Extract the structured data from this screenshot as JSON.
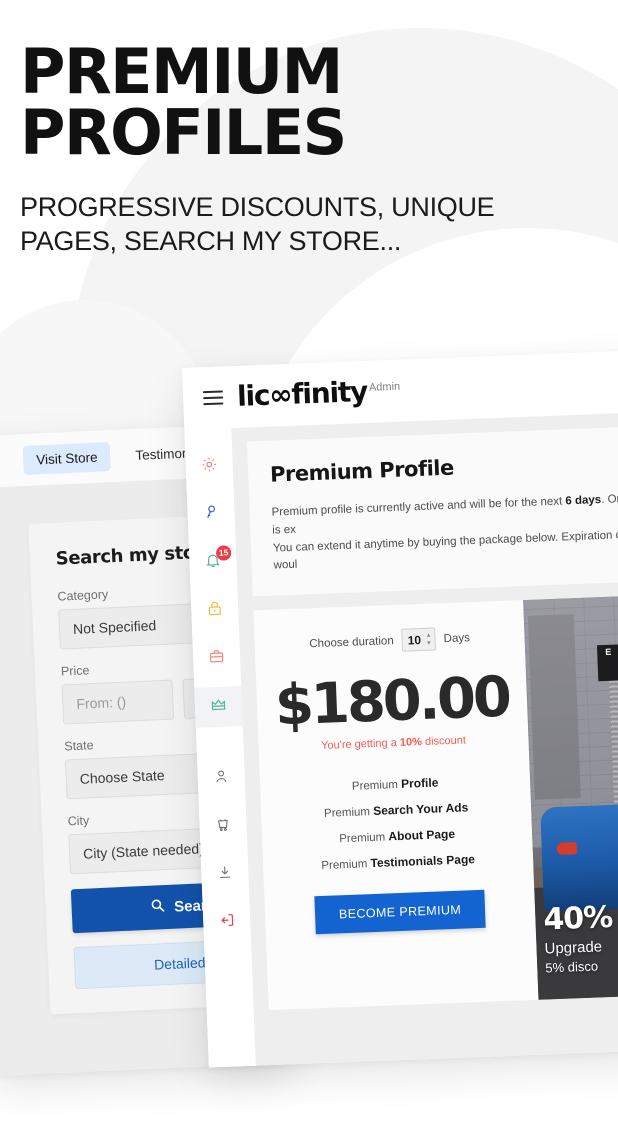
{
  "poster": {
    "headline": "PREMIUM\nPROFILES",
    "subheadline": "PROGRESSIVE DISCOUNTS, UNIQUE\nPAGES, SEARCH MY STORE..."
  },
  "colors": {
    "accent_blue": "#1363d0",
    "search_blue": "#1252ab",
    "discount_red": "#f35d52",
    "badge_red": "#ef3b45",
    "tab_active_bg": "#dbeafc",
    "page_bg": "#ffffff",
    "arch_grey": "#f4f4f4"
  },
  "left_window": {
    "tabs": [
      {
        "label": "Visit Store",
        "active": true
      },
      {
        "label": "Testimon",
        "active": false
      }
    ],
    "panel": {
      "title": "Search my store",
      "fields": [
        {
          "label": "Category",
          "value": "Not Specified"
        },
        {
          "label": "Price",
          "value": "From: ()",
          "value2": ""
        },
        {
          "label": "State",
          "value": "Choose State"
        },
        {
          "label": "City",
          "value": "City (State needed)"
        }
      ],
      "search_button": "Search",
      "search_icon": "search-icon",
      "detailed_button": "Detailed Se"
    }
  },
  "admin_window": {
    "topbar": {
      "menu_icon": "hamburger-icon",
      "brand": "lic∞finity",
      "brand_suffix": "Admin"
    },
    "sidebar": [
      {
        "name": "settings",
        "icon": "gear-icon",
        "color": "#f0736b",
        "badge": null,
        "active": false
      },
      {
        "name": "key",
        "icon": "key-icon",
        "color": "#3b62c9",
        "badge": null,
        "active": false
      },
      {
        "name": "notifications",
        "icon": "bell-icon",
        "color": "#4cae94",
        "badge": "15",
        "active": false
      },
      {
        "name": "lock",
        "icon": "lock-icon",
        "color": "#eebc3a",
        "badge": null,
        "active": false
      },
      {
        "name": "briefcase",
        "icon": "briefcase-icon",
        "color": "#ef8d7c",
        "badge": null,
        "active": false
      },
      {
        "name": "premium",
        "icon": "crown-icon",
        "color": "#57b894",
        "badge": null,
        "active": true
      },
      {
        "name": "profile",
        "icon": "person-icon",
        "color": "#6d6d6d",
        "badge": null,
        "active": false
      },
      {
        "name": "cart",
        "icon": "cart-icon",
        "color": "#6d6d6d",
        "badge": null,
        "active": false
      },
      {
        "name": "download",
        "icon": "download-icon",
        "color": "#6d6d6d",
        "badge": null,
        "active": false
      },
      {
        "name": "logout",
        "icon": "logout-icon",
        "color": "#ef3b45",
        "badge": null,
        "active": false
      }
    ],
    "page": {
      "title": "Premium Profile",
      "description_line1_a": "Premium profile is currently active and will be for the next ",
      "description_days": "6 days",
      "description_line1_b": ". Once it is ex",
      "description_line2": "You can extend it anytime by buying the package below. Expiration date woul"
    },
    "buy": {
      "duration_label": "Choose duration",
      "duration_value": "10",
      "duration_unit": "Days",
      "price": "$180.00",
      "discount_prefix": "You're getting a ",
      "discount_amount": "10%",
      "discount_suffix": " discount",
      "features": [
        {
          "prefix": "Premium ",
          "bold": "Profile"
        },
        {
          "prefix": "Premium ",
          "bold": "Search Your Ads"
        },
        {
          "prefix": "Premium ",
          "bold": "About Page"
        },
        {
          "prefix": "Premium ",
          "bold": "Testimonials Page"
        }
      ],
      "cta": "BECOME PREMIUM"
    },
    "promo": {
      "sign_text": "E",
      "percent": "40%",
      "line1": "Upgrade",
      "line2": "5% disco"
    }
  }
}
